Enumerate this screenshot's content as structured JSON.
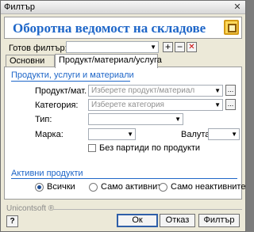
{
  "window": {
    "title": "Филтър",
    "close_glyph": "✕"
  },
  "header": {
    "title": "Оборотна ведомост на складове",
    "icon": "report-icon"
  },
  "filter": {
    "label": "Готов филтър:",
    "value": "",
    "add_glyph": "+",
    "remove_glyph": "−",
    "clear_glyph": "✕"
  },
  "tabs": [
    {
      "label": "Основни",
      "active": false
    },
    {
      "label": "Продукт/материал/услуга",
      "active": true
    }
  ],
  "products": {
    "section_title": "Продукти, услуги и материали",
    "product_label": "Продукт/мат.",
    "product_placeholder": "Изберете продукт/материал",
    "category_label": "Категория:",
    "category_placeholder": "Изберете категория",
    "type_label": "Тип:",
    "type_value": "",
    "brand_label": "Марка:",
    "brand_value": "",
    "currency_label": "Валута:",
    "currency_value": "",
    "no_batches_label": "Без партиди по продукти",
    "no_batches_checked": false,
    "browse_glyph": "..."
  },
  "active_products": {
    "section_title": "Активни продукти",
    "options": [
      {
        "label": "Всички",
        "checked": true
      },
      {
        "label": "Само активните",
        "checked": false
      },
      {
        "label": "Само неактивните",
        "checked": false
      }
    ]
  },
  "footer": {
    "brand": "Unicontsoft ®",
    "help_glyph": "?",
    "ok_label": "Ок",
    "cancel_label": "Отказ",
    "filter_label": "Филтър"
  }
}
